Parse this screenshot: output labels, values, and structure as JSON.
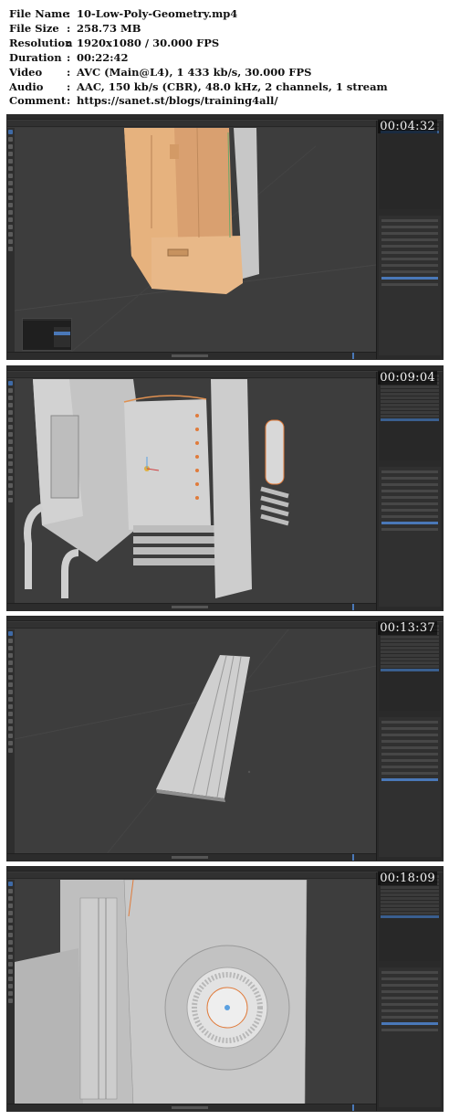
{
  "file_info": {
    "file_name": {
      "label": "File Name",
      "value": "10-Low-Poly-Geometry.mp4"
    },
    "file_size": {
      "label": "File Size",
      "value": "258.73 MB"
    },
    "resolution": {
      "label": "Resolution",
      "value": "1920x1080 / 30.000 FPS"
    },
    "duration": {
      "label": "Duration",
      "value": "00:22:42"
    },
    "video": {
      "label": "Video",
      "value": "AVC (Main@L4), 1 433 kb/s, 30.000 FPS"
    },
    "audio": {
      "label": "Audio",
      "value": "AAC, 150 kb/s (CBR), 48.0 kHz, 2 channels, 1 stream"
    },
    "comment": {
      "label": "Comment",
      "value": "https://sanet.st/blogs/training4all/"
    },
    "separator": ":"
  },
  "frames": [
    {
      "timestamp": "00:04:32"
    },
    {
      "timestamp": "00:09:04"
    },
    {
      "timestamp": "00:13:37"
    },
    {
      "timestamp": "00:18:09"
    }
  ],
  "colors": {
    "viewport_bg": "#3d3d3d",
    "panel_bg": "#2a2a2a",
    "selection_orange": "#e0a060",
    "accent_blue": "#4a78b8",
    "model_grey": "#c9c9c9"
  }
}
